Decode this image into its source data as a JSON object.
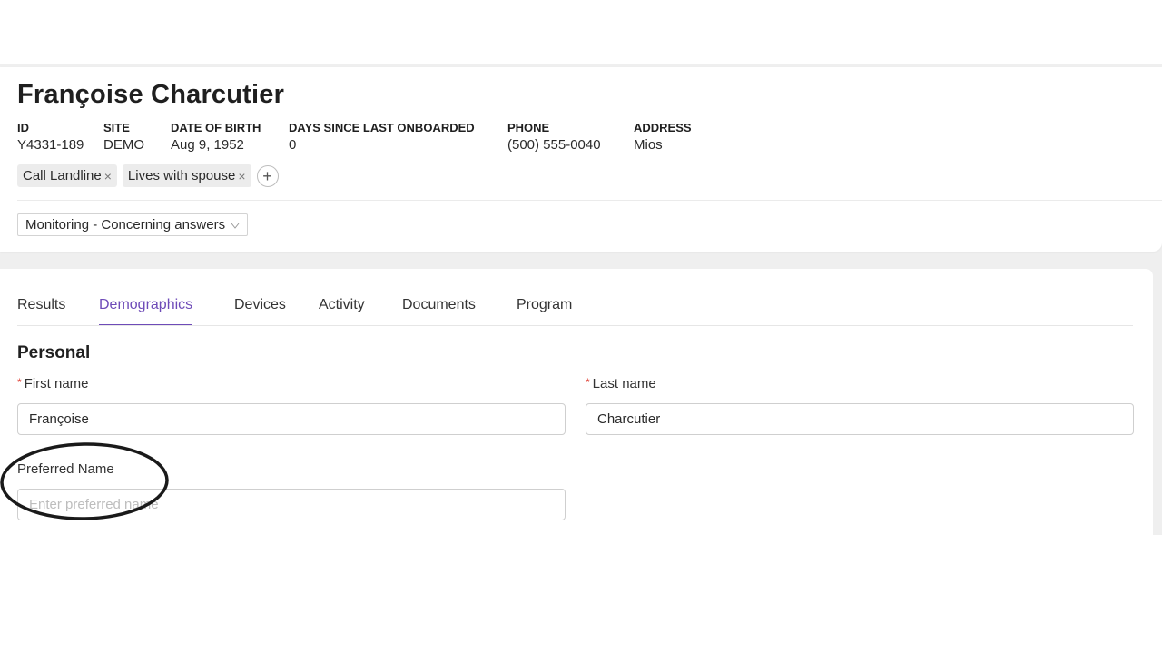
{
  "patient": {
    "name": "Françoise Charcutier",
    "meta": [
      {
        "label": "ID",
        "value": "Y4331-189"
      },
      {
        "label": "SITE",
        "value": "DEMO"
      },
      {
        "label": "DATE OF BIRTH",
        "value": "Aug 9, 1952"
      },
      {
        "label": "DAYS SINCE LAST ONBOARDED",
        "value": "0"
      },
      {
        "label": "PHONE",
        "value": "(500) 555-0040"
      },
      {
        "label": "ADDRESS",
        "value": "Mios"
      }
    ],
    "tags": [
      {
        "label": "Call Landline",
        "close": "×"
      },
      {
        "label": "Lives with spouse",
        "close": "×"
      }
    ],
    "add_tag_symbol": "+",
    "status": {
      "selected": "Monitoring - Concerning answers",
      "icon": "chevron-down-icon"
    }
  },
  "tabs": [
    {
      "label": "Results",
      "active": false
    },
    {
      "label": "Demographics",
      "active": true
    },
    {
      "label": "Devices",
      "active": false
    },
    {
      "label": "Activity",
      "active": false
    },
    {
      "label": "Documents",
      "active": false
    },
    {
      "label": "Program",
      "active": false
    }
  ],
  "personal": {
    "title": "Personal",
    "first_name": {
      "label": "First name",
      "required_mark": "*",
      "value": "Françoise"
    },
    "last_name": {
      "label": "Last name",
      "required_mark": "*",
      "value": "Charcutier"
    },
    "preferred_name": {
      "label": "Preferred Name",
      "placeholder": "Enter preferred name",
      "value": ""
    }
  },
  "colors": {
    "accent": "#6e4bb8",
    "required": "#e0453a",
    "annotation": "#1a1a1a"
  }
}
